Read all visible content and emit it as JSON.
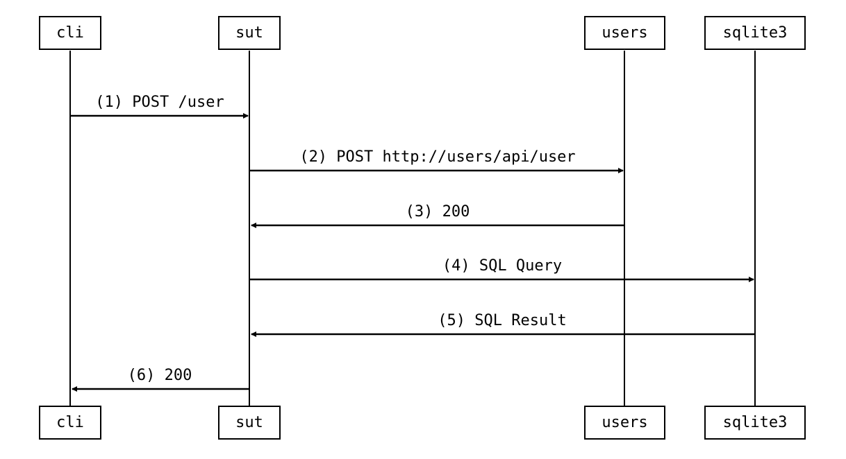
{
  "diagram": {
    "participants": {
      "cli": "cli",
      "sut": "sut",
      "users": "users",
      "sqlite3": "sqlite3"
    },
    "messages": {
      "m1": "(1) POST /user",
      "m2": "(2) POST http://users/api/user",
      "m3": "(3) 200",
      "m4": "(4) SQL Query",
      "m5": "(5) SQL Result",
      "m6": "(6) 200"
    }
  }
}
